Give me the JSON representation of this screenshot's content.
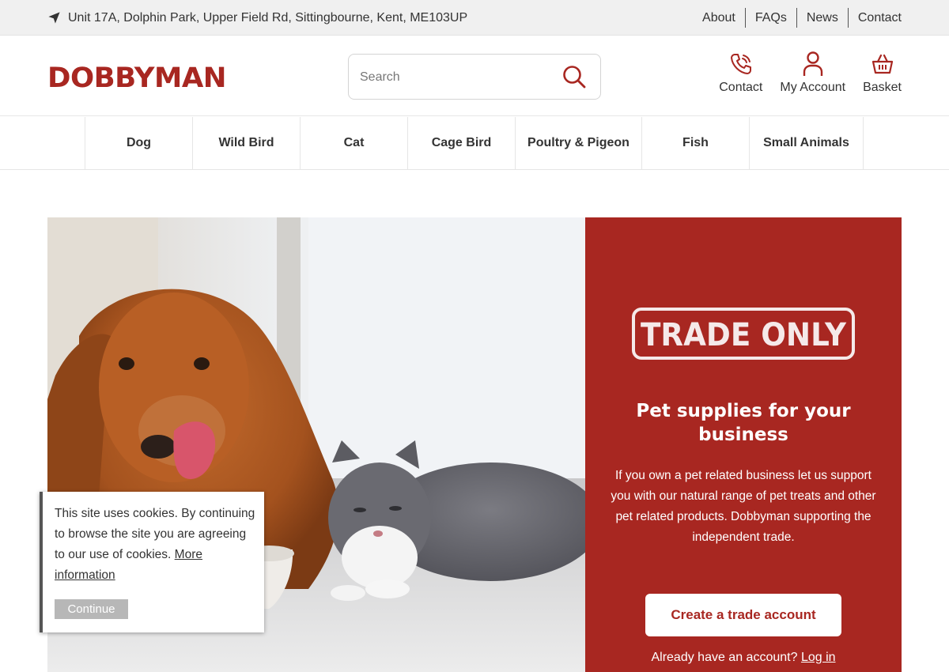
{
  "topbar": {
    "address": "Unit 17A, Dolphin Park, Upper Field Rd, Sittingbourne, Kent, ME103UP",
    "links": [
      "About",
      "FAQs",
      "News",
      "Contact"
    ]
  },
  "header": {
    "logo": "DOBBYMAN",
    "search_placeholder": "Search",
    "icons": {
      "contact": "Contact",
      "account": "My Account",
      "basket": "Basket"
    }
  },
  "nav": {
    "categories": [
      "Dog",
      "Wild Bird",
      "Cat",
      "Cage Bird",
      "Poultry & Pigeon",
      "Fish",
      "Small Animals"
    ]
  },
  "hero": {
    "stamp": "TRADE ONLY",
    "heading": "Pet supplies for your business",
    "body": "If you own a pet related business let us support you with our natural range of pet treats and other pet related products. Dobbyman supporting the independent trade.",
    "button": "Create a trade account",
    "login_prompt": "Already have an account?",
    "login_link": "Log in"
  },
  "cookie": {
    "text": "This site uses cookies. By continuing to browse the site you are agreeing to our use of cookies.",
    "more": "More information",
    "button": "Continue"
  },
  "colors": {
    "brand": "#a82721",
    "topbar": "#f0f0f0"
  }
}
